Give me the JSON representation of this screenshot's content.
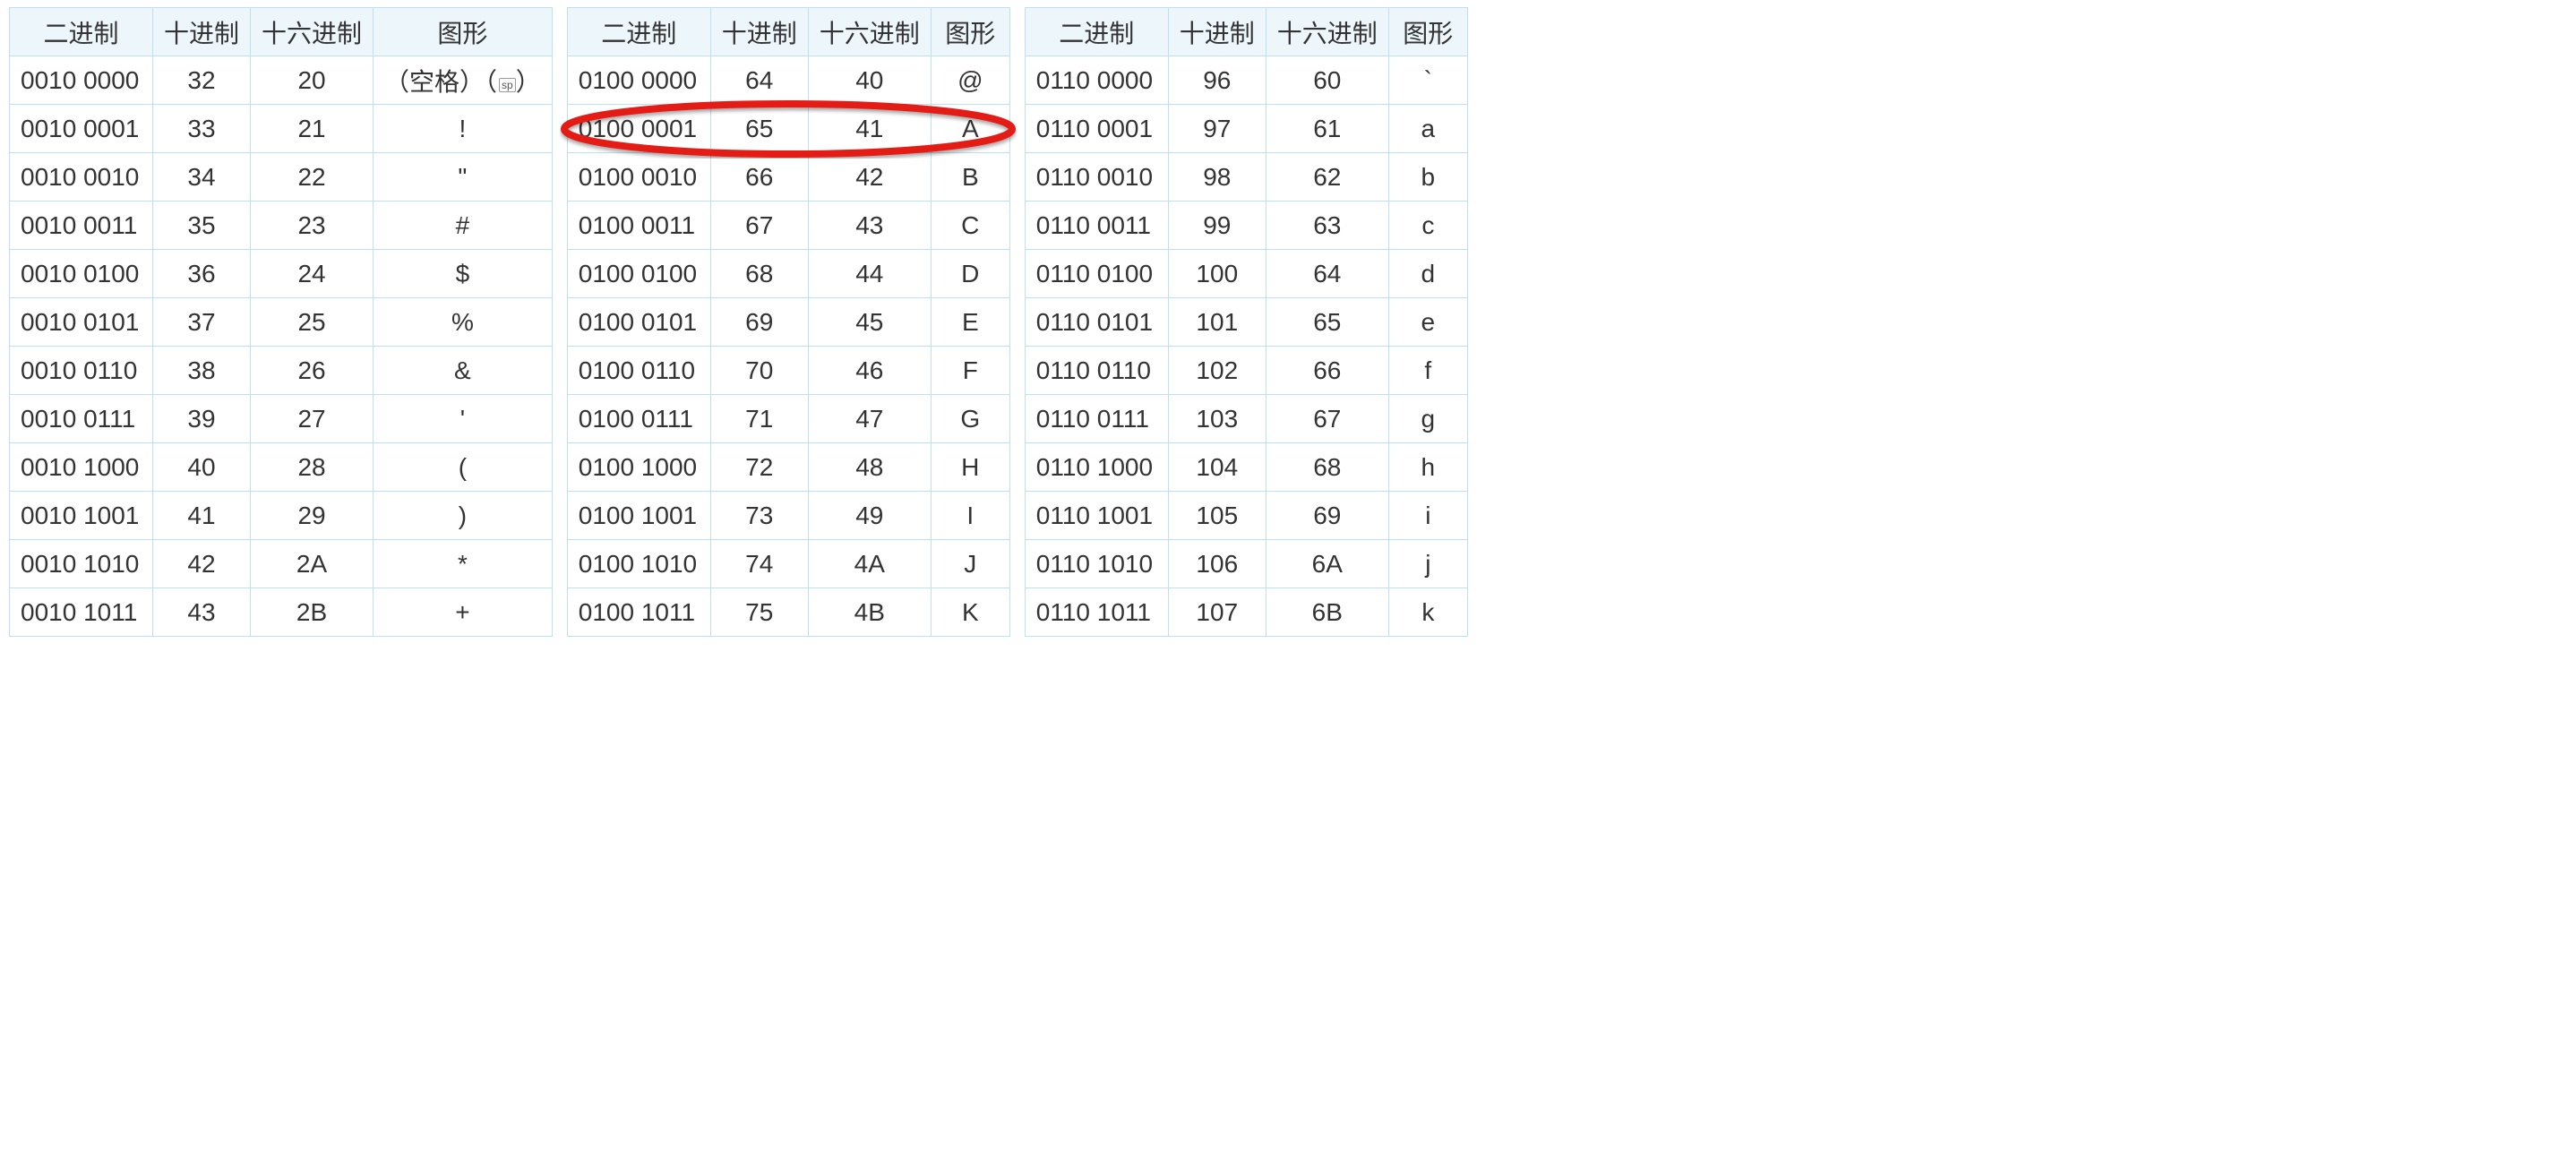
{
  "headers": {
    "bin": "二进制",
    "dec": "十进制",
    "hex": "十六进制",
    "glyph": "图形"
  },
  "space_label_prefix": "（空格）（",
  "space_label_tag": "sp",
  "space_label_suffix": "）",
  "blocks": [
    {
      "rows": [
        {
          "bin": "0010 0000",
          "dec": "32",
          "hex": "20",
          "glyph": "__SPACE__"
        },
        {
          "bin": "0010 0001",
          "dec": "33",
          "hex": "21",
          "glyph": "!"
        },
        {
          "bin": "0010 0010",
          "dec": "34",
          "hex": "22",
          "glyph": "\""
        },
        {
          "bin": "0010 0011",
          "dec": "35",
          "hex": "23",
          "glyph": "#"
        },
        {
          "bin": "0010 0100",
          "dec": "36",
          "hex": "24",
          "glyph": "$"
        },
        {
          "bin": "0010 0101",
          "dec": "37",
          "hex": "25",
          "glyph": "%"
        },
        {
          "bin": "0010 0110",
          "dec": "38",
          "hex": "26",
          "glyph": "&"
        },
        {
          "bin": "0010 0111",
          "dec": "39",
          "hex": "27",
          "glyph": "'"
        },
        {
          "bin": "0010 1000",
          "dec": "40",
          "hex": "28",
          "glyph": "("
        },
        {
          "bin": "0010 1001",
          "dec": "41",
          "hex": "29",
          "glyph": ")"
        },
        {
          "bin": "0010 1010",
          "dec": "42",
          "hex": "2A",
          "glyph": "*"
        },
        {
          "bin": "0010 1011",
          "dec": "43",
          "hex": "2B",
          "glyph": "+"
        }
      ]
    },
    {
      "rows": [
        {
          "bin": "0100 0000",
          "dec": "64",
          "hex": "40",
          "glyph": "@"
        },
        {
          "bin": "0100 0001",
          "dec": "65",
          "hex": "41",
          "glyph": "A"
        },
        {
          "bin": "0100 0010",
          "dec": "66",
          "hex": "42",
          "glyph": "B"
        },
        {
          "bin": "0100 0011",
          "dec": "67",
          "hex": "43",
          "glyph": "C"
        },
        {
          "bin": "0100 0100",
          "dec": "68",
          "hex": "44",
          "glyph": "D"
        },
        {
          "bin": "0100 0101",
          "dec": "69",
          "hex": "45",
          "glyph": "E"
        },
        {
          "bin": "0100 0110",
          "dec": "70",
          "hex": "46",
          "glyph": "F"
        },
        {
          "bin": "0100 0111",
          "dec": "71",
          "hex": "47",
          "glyph": "G"
        },
        {
          "bin": "0100 1000",
          "dec": "72",
          "hex": "48",
          "glyph": "H"
        },
        {
          "bin": "0100 1001",
          "dec": "73",
          "hex": "49",
          "glyph": "I"
        },
        {
          "bin": "0100 1010",
          "dec": "74",
          "hex": "4A",
          "glyph": "J"
        },
        {
          "bin": "0100 1011",
          "dec": "75",
          "hex": "4B",
          "glyph": "K"
        }
      ],
      "highlight_row": 1
    },
    {
      "rows": [
        {
          "bin": "0110 0000",
          "dec": "96",
          "hex": "60",
          "glyph": "`"
        },
        {
          "bin": "0110 0001",
          "dec": "97",
          "hex": "61",
          "glyph": "a"
        },
        {
          "bin": "0110 0010",
          "dec": "98",
          "hex": "62",
          "glyph": "b"
        },
        {
          "bin": "0110 0011",
          "dec": "99",
          "hex": "63",
          "glyph": "c"
        },
        {
          "bin": "0110 0100",
          "dec": "100",
          "hex": "64",
          "glyph": "d"
        },
        {
          "bin": "0110 0101",
          "dec": "101",
          "hex": "65",
          "glyph": "e"
        },
        {
          "bin": "0110 0110",
          "dec": "102",
          "hex": "66",
          "glyph": "f"
        },
        {
          "bin": "0110 0111",
          "dec": "103",
          "hex": "67",
          "glyph": "g"
        },
        {
          "bin": "0110 1000",
          "dec": "104",
          "hex": "68",
          "glyph": "h"
        },
        {
          "bin": "0110 1001",
          "dec": "105",
          "hex": "69",
          "glyph": "i"
        },
        {
          "bin": "0110 1010",
          "dec": "106",
          "hex": "6A",
          "glyph": "j"
        },
        {
          "bin": "0110 1011",
          "dec": "107",
          "hex": "6B",
          "glyph": "k"
        }
      ]
    }
  ],
  "annotation": {
    "color": "#e31b13"
  }
}
